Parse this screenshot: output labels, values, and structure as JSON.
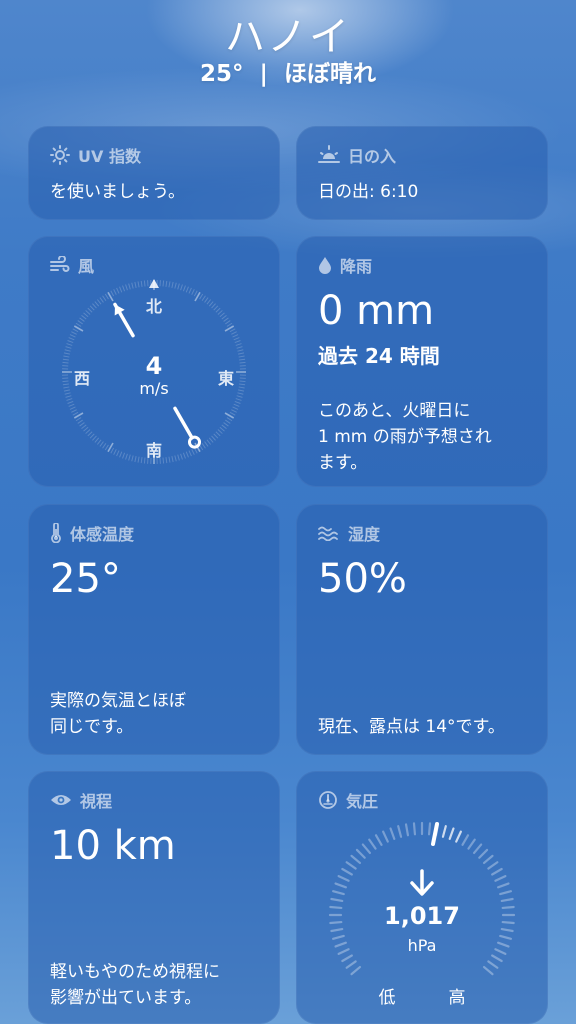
{
  "header": {
    "city": "ハノイ",
    "temperature": "25°",
    "separator": "|",
    "condition": "ほぼ晴れ"
  },
  "uv_card": {
    "title": "UV 指数",
    "text": "を使いましょう。",
    "icon": "sun-icon"
  },
  "sunset_card": {
    "title": "日の入",
    "text": "日の出: 6:10",
    "icon": "sunset-icon"
  },
  "wind_card": {
    "title": "風",
    "icon": "wind-icon",
    "speed": "4",
    "unit": "m/s",
    "directions": {
      "north": "北",
      "south": "南",
      "east": "東",
      "west": "西"
    },
    "direction_degrees": 330
  },
  "precip_card": {
    "title": "降雨",
    "icon": "raindrop-icon",
    "value": "0 mm",
    "period": "過去 24 時間",
    "forecast_line1": "このあと、火曜日に",
    "forecast_line2": "1 mm の雨が予想され",
    "forecast_line3": "ます。"
  },
  "feels_like_card": {
    "title": "体感温度",
    "icon": "thermometer-icon",
    "value": "25°",
    "desc_line1": "実際の気温とほぼ",
    "desc_line2": "同じです。"
  },
  "humidity_card": {
    "title": "湿度",
    "icon": "humidity-icon",
    "value": "50%",
    "desc": "現在、露点は 14°です。"
  },
  "visibility_card": {
    "title": "視程",
    "icon": "eye-icon",
    "value": "10 km",
    "desc_line1": "軽いもやのため視程に",
    "desc_line2": "影響が出ています。"
  },
  "pressure_card": {
    "title": "気圧",
    "icon": "gauge-icon",
    "value": "1,017",
    "unit": "hPa",
    "trend": "down",
    "low_label": "低",
    "high_label": "高"
  },
  "colors": {
    "card_background": "rgba(40, 95, 175, 0.55)",
    "title_text": "rgba(255,255,255,0.62)",
    "text": "#ffffff"
  }
}
